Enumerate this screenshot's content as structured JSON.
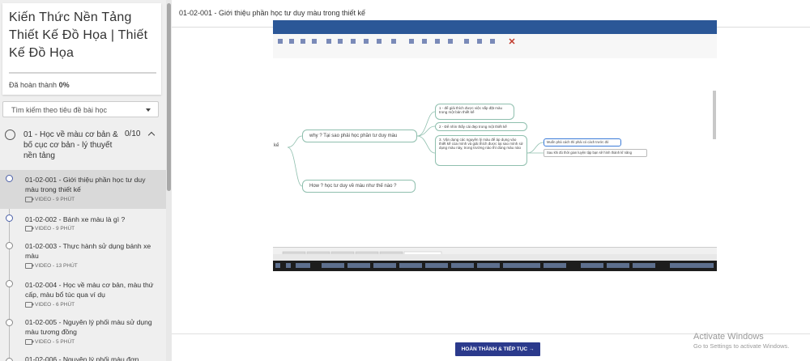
{
  "course": {
    "title": "Kiến Thức Nền Tảng Thiết Kế Đồ Họa | Thiết Kế Đồ Họa",
    "progress_label": "Đã hoàn thành",
    "progress_value": "0%"
  },
  "search": {
    "placeholder": "Tìm kiếm theo tiêu đề bài học"
  },
  "section": {
    "title": "01 - Học về màu cơ bản & bố cục cơ bản - lý thuyết nền tảng",
    "count": "0/10"
  },
  "lessons": [
    {
      "title": "01-02-001 - Giới thiệu phần học tư duy màu trong thiết kế",
      "meta": "VIDEO - 9 PHÚT"
    },
    {
      "title": "01-02-002 - Bánh xe màu là gì ?",
      "meta": "VIDEO - 9 PHÚT"
    },
    {
      "title": "01-02-003 - Thực hành sử dụng bánh xe màu",
      "meta": "VIDEO - 13 PHÚT"
    },
    {
      "title": "01-02-004 - Học về màu cơ bản, màu thứ cấp, màu bổ túc qua ví dụ",
      "meta": "VIDEO - 6 PHÚT"
    },
    {
      "title": "01-02-005 - Nguyên lý phối màu sử dụng màu tương đồng",
      "meta": "VIDEO - 5 PHÚT"
    },
    {
      "title": "01-02-006 - Nguyên lý phối màu đơn",
      "meta": ""
    }
  ],
  "header": {
    "title": "01-02-001 - Giới thiệu phần học tư duy màu trong thiết kế"
  },
  "mindmap": {
    "root": "kế",
    "why": "why ? Tại sao phải học phần tư duy màu",
    "how": "How ? học tư duy về màu như thế nào ?",
    "point1": "1 - để giải thích được việc sắp đặt màu trong một bản thiết kế",
    "point2": "2 - Để nhìn thấy cái đẹp trong một thiết kế",
    "point3": "3. Vận dụng các nguyên lý màu để áp dụng vào thiết kế của mình và giải thích được tại sao mình sử dụng màu này, trong trường nào thì dùng màu nào",
    "sub1": "Muốn phá cách thì phải có cách trước đó",
    "sub2": "Sau khi đủ thời gian luyện tập bạn sẽ hình thành kĩ năng"
  },
  "footer": {
    "button": "HOÀN THÀNH & TIẾP TỤC →"
  },
  "watermark": {
    "line1": "Activate Windows",
    "line2": "Go to Settings to activate Windows."
  },
  "colors": {
    "accent": "#2b3a8c",
    "node_border": "#8fbfae"
  }
}
